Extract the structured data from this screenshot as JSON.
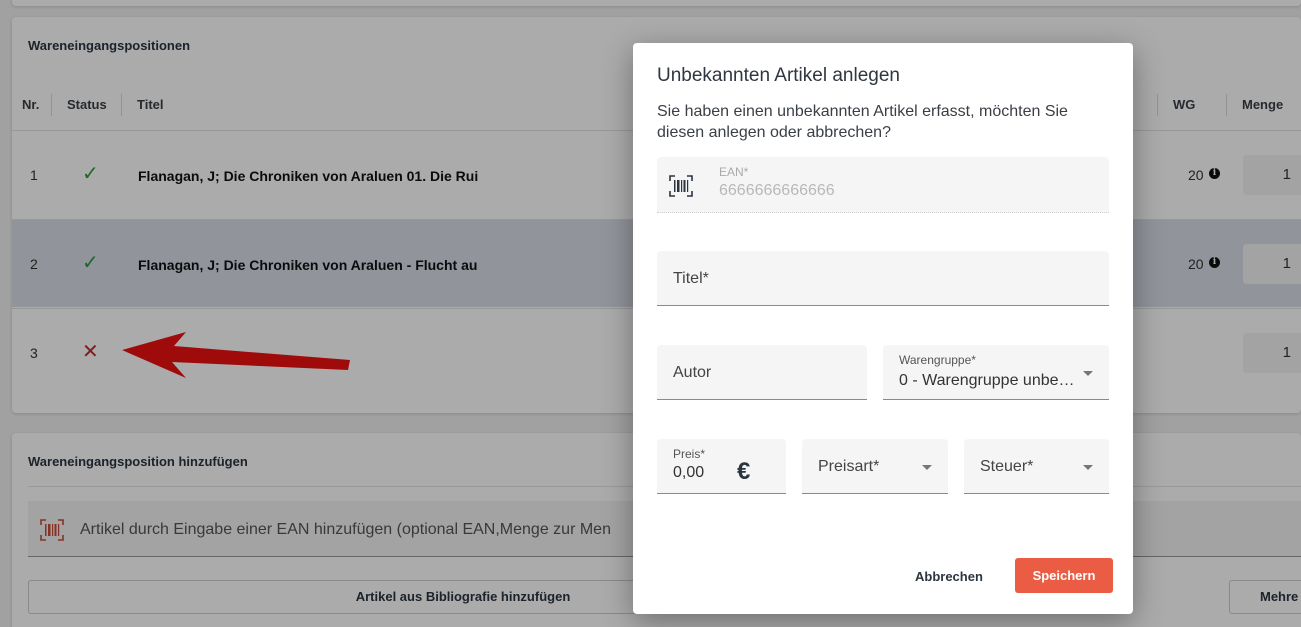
{
  "table_card": {
    "title": "Wareneingangspositionen",
    "headers": {
      "nr": "Nr.",
      "status": "Status",
      "titel": "Titel",
      "wg": "WG",
      "menge": "Menge"
    },
    "rows": [
      {
        "nr": "1",
        "status": "✓",
        "status_color": "#2e9a3c",
        "title": "Flanagan, J; Die Chroniken von Araluen 01. Die Rui",
        "wg": "20",
        "qty": "1"
      },
      {
        "nr": "2",
        "status": "✓",
        "status_color": "#2e9a3c",
        "title": "Flanagan, J; Die Chroniken von Araluen - Flucht au",
        "wg": "20",
        "qty": "1"
      },
      {
        "nr": "3",
        "status": "✕",
        "status_color": "#c62828",
        "title": "",
        "wg": "",
        "qty": "1"
      }
    ]
  },
  "add_card": {
    "title": "Wareneingangsposition hinzufügen",
    "ean_input_label": "Artikel durch Eingabe einer EAN hinzufügen (optional EAN,Menge zur Men",
    "biblio_button": "Artikel aus Bibliografie hinzufügen",
    "more_button": "Mehre"
  },
  "dialog": {
    "title": "Unbekannten Artikel anlegen",
    "message": "Sie haben einen unbekannten Artikel erfasst, möchten Sie diesen anlegen oder abbrechen?",
    "ean": {
      "label": "EAN*",
      "value": "6666666666666"
    },
    "titel": {
      "placeholder": "Titel*"
    },
    "autor": {
      "placeholder": "Autor"
    },
    "warengruppe": {
      "label": "Warengruppe*",
      "value": "0 - Warengruppe unbe…"
    },
    "preis": {
      "label": "Preis*",
      "value": "0,00",
      "currency": "€"
    },
    "preisart": {
      "placeholder": "Preisart*"
    },
    "steuer": {
      "placeholder": "Steuer*"
    },
    "cancel_label": "Abbrechen",
    "save_label": "Speichern"
  },
  "colors": {
    "accent": "#ea5c43",
    "arrow": "#ee1111",
    "ok": "#2e9a3c",
    "error": "#c62828"
  },
  "icons": {
    "barcode": "barcode-icon",
    "info": "info-icon",
    "dropdown": "chevron-down-icon",
    "arrow": "red-arrow-annotation"
  }
}
